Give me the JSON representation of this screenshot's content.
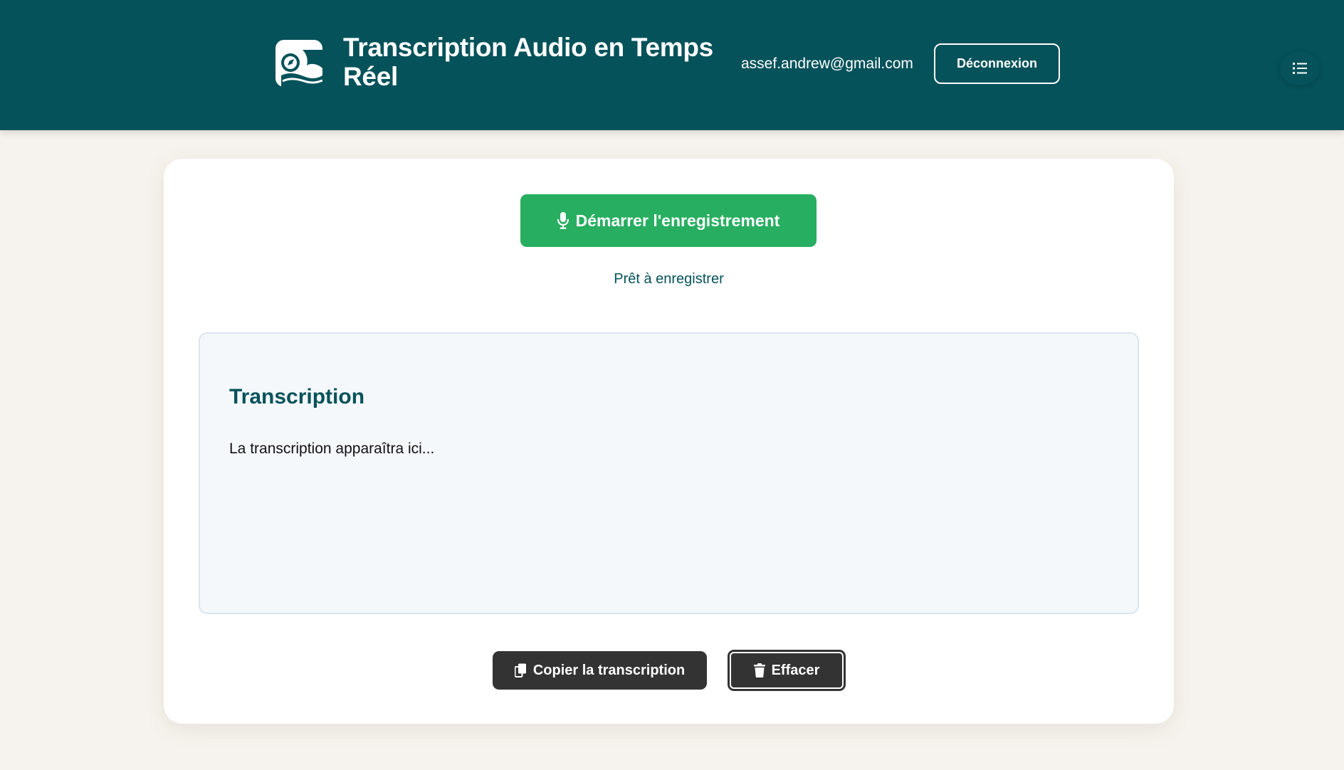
{
  "header": {
    "title": "Transcription Audio en Temps Réel",
    "user_email": "assef.andrew@gmail.com",
    "logout_label": "Déconnexion",
    "logo_icon": "app-logo-icon",
    "menu_icon": "list-menu-icon",
    "background_color": "#05525a"
  },
  "recorder": {
    "start_label": "Démarrer l'enregistrement",
    "start_icon": "microphone-icon",
    "status": "Prêt à enregistrer",
    "button_color": "#27ae60"
  },
  "transcription": {
    "heading": "Transcription",
    "placeholder": "La transcription apparaîtra ici..."
  },
  "actions": {
    "copy_label": "Copier la transcription",
    "copy_icon": "copy-icon",
    "clear_label": "Effacer",
    "clear_icon": "trash-icon",
    "button_color": "#333333"
  }
}
